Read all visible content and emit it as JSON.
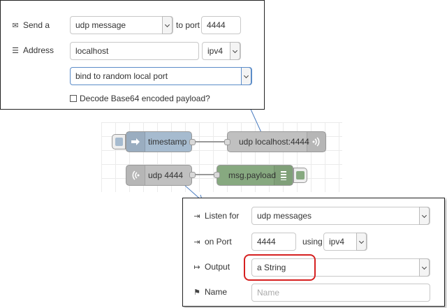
{
  "send_panel": {
    "send_label": "Send a",
    "send_type": "udp message",
    "to_port_label": "to port",
    "port": "4444",
    "address_label": "Address",
    "address": "localhost",
    "ip_version": "ipv4",
    "bind_option": "bind to random local port",
    "decode_label": "Decode Base64 encoded payload?"
  },
  "flow": {
    "timestamp_label": "timestamp",
    "udp_out_label": "udp localhost:4444",
    "udp_in_label": "udp 4444",
    "debug_label": "msg.payload"
  },
  "listen_panel": {
    "listen_label": "Listen for",
    "listen_type": "udp messages",
    "on_port_label": "on Port",
    "port": "4444",
    "using_label": "using",
    "ip_version": "ipv4",
    "output_label": "Output",
    "output_type": "a String",
    "name_label": "Name",
    "name_placeholder": "Name"
  },
  "colors": {
    "inject_node": "#a6bbcf",
    "udp_node": "#c0c0c0",
    "debug_node": "#87a980",
    "connector": "#4a7cc0",
    "highlight": "#d62020"
  }
}
